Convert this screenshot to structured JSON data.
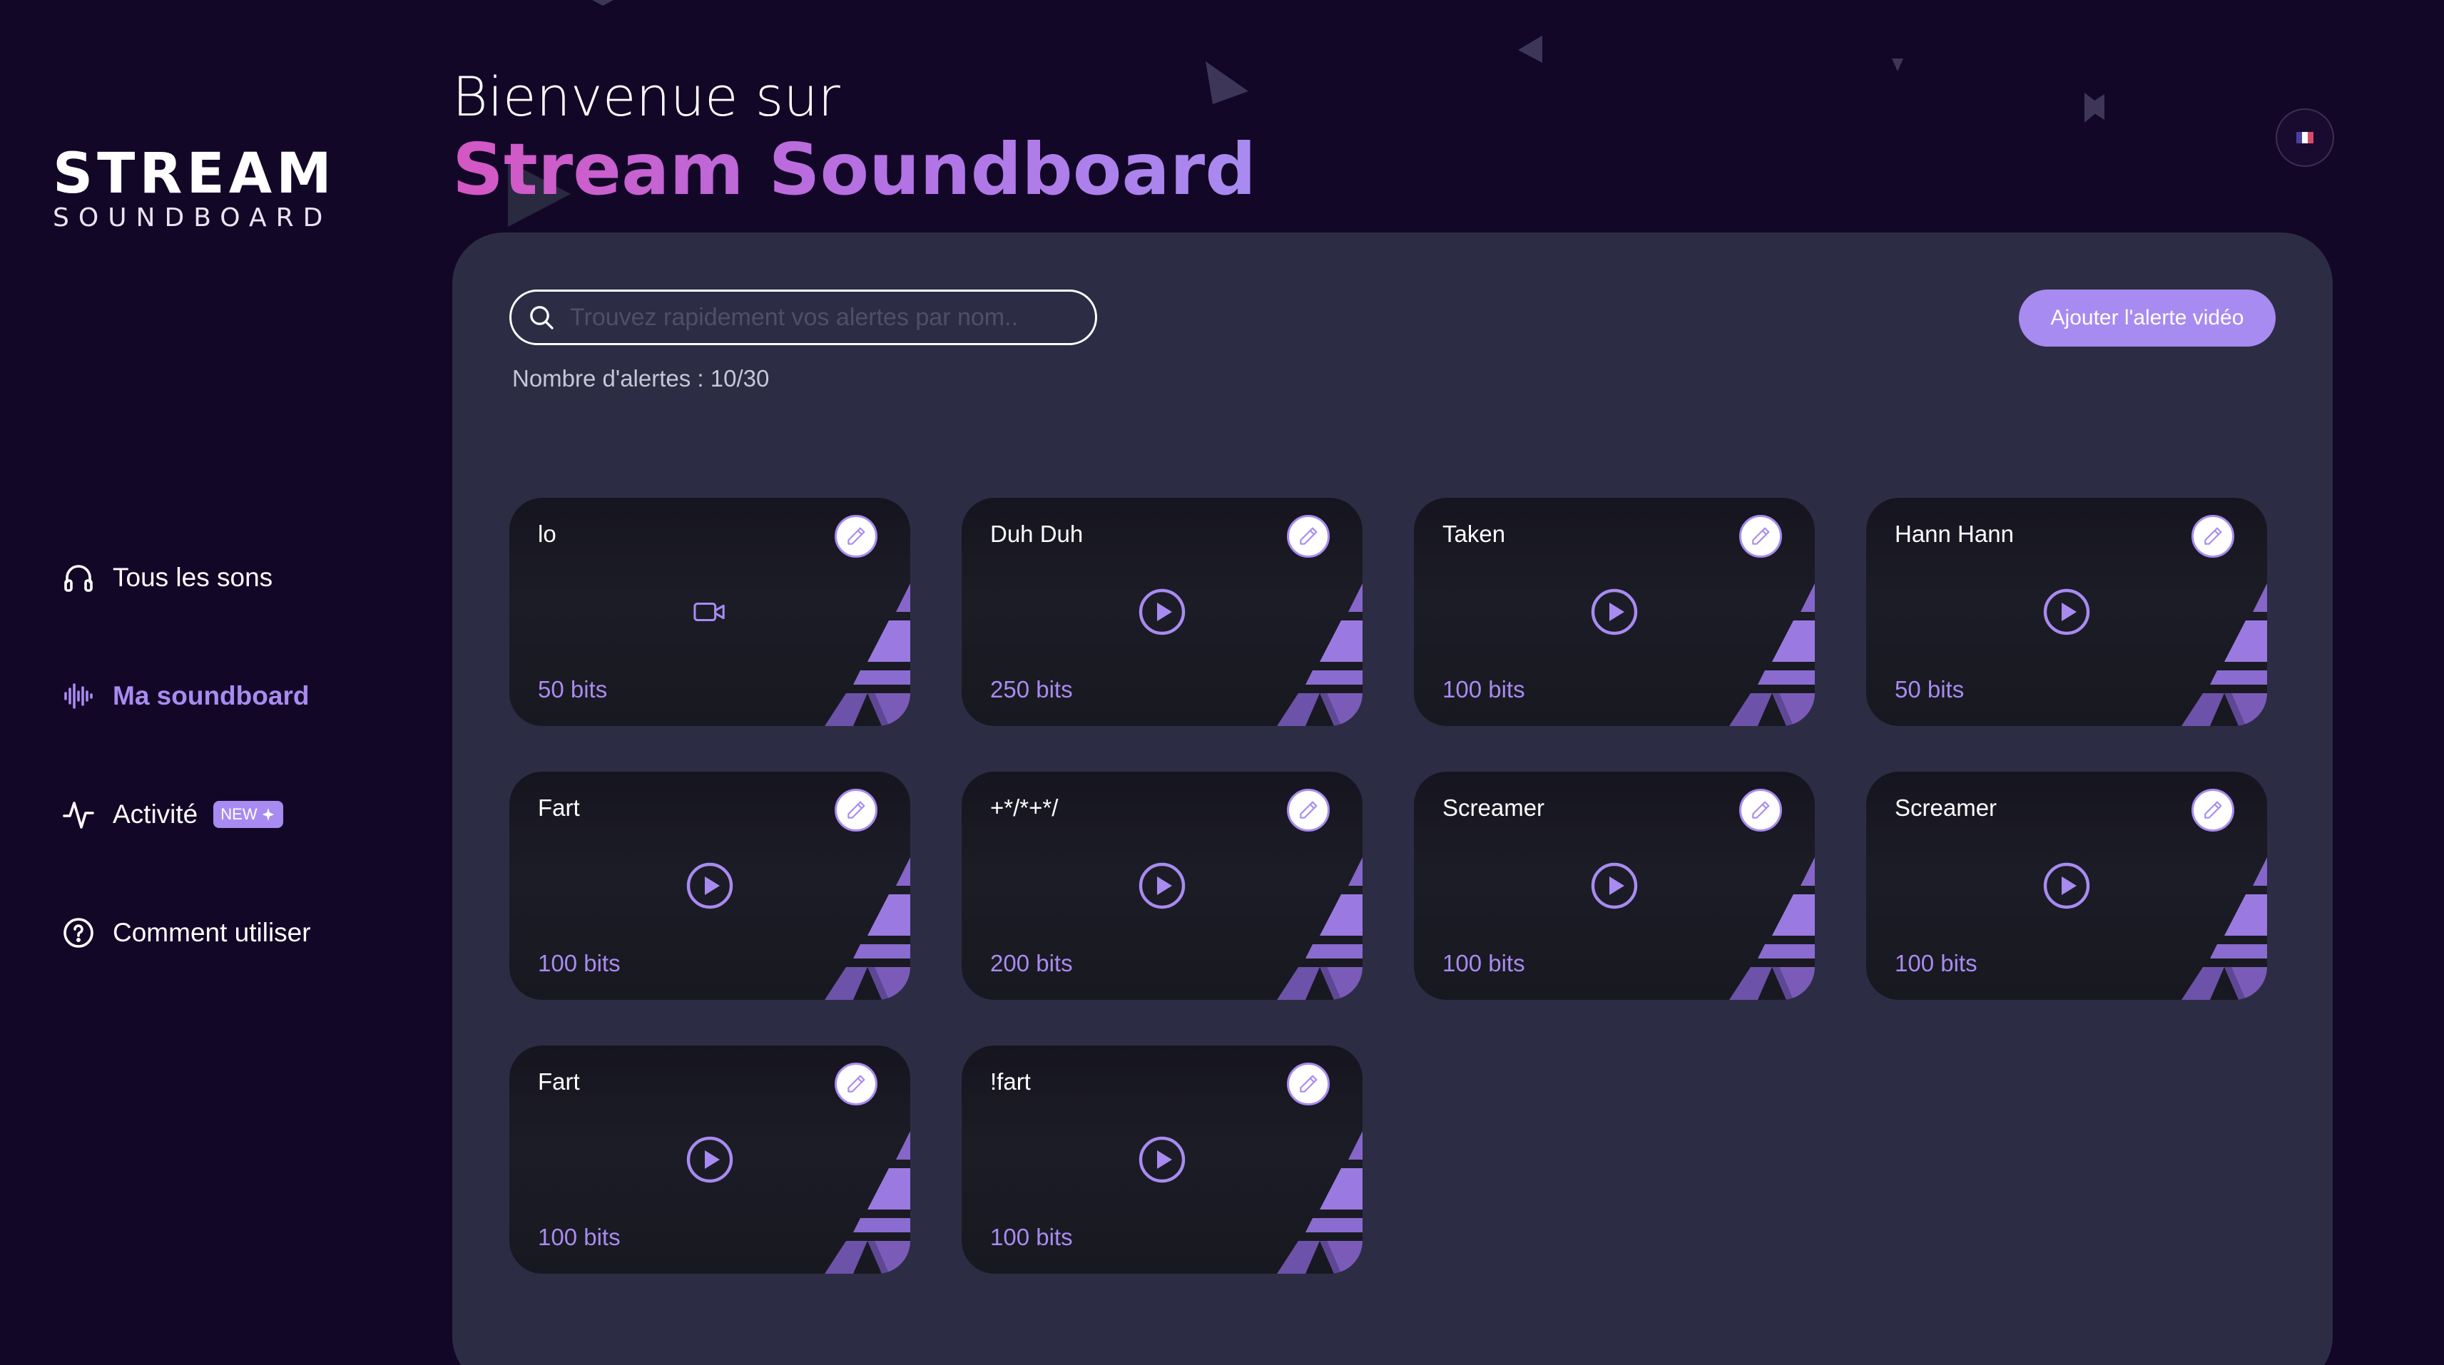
{
  "logo": {
    "title": "STREAM",
    "subtitle": "SOUNDBOARD"
  },
  "nav": [
    {
      "label": "Tous les sons",
      "icon": "headphones-icon",
      "active": false
    },
    {
      "label": "Ma soundboard",
      "icon": "soundwave-icon",
      "active": true
    },
    {
      "label": "Activité",
      "icon": "activity-icon",
      "active": false,
      "badge": "NEW"
    },
    {
      "label": "Comment utiliser",
      "icon": "help-circle-icon",
      "active": false
    }
  ],
  "header": {
    "welcome": "Bienvenue sur",
    "brand": "Stream Soundboard"
  },
  "search": {
    "placeholder": "Trouvez rapidement vos alertes par nom..",
    "value": ""
  },
  "alerts_count": "Nombre d'alertes : 10/30",
  "add_button": "Ajouter l'alerte vidéo",
  "cards": [
    {
      "name": "lo",
      "price": "50 bits",
      "icon": "video-camera-icon"
    },
    {
      "name": "Duh Duh",
      "price": "250 bits",
      "icon": "play-icon"
    },
    {
      "name": "Taken",
      "price": "100 bits",
      "icon": "play-icon"
    },
    {
      "name": "Hann Hann",
      "price": "50 bits",
      "icon": "play-icon"
    },
    {
      "name": "Fart",
      "price": "100 bits",
      "icon": "play-icon"
    },
    {
      "name": "+*/*+*/",
      "price": "200 bits",
      "icon": "play-icon"
    },
    {
      "name": "Screamer",
      "price": "100 bits",
      "icon": "play-icon"
    },
    {
      "name": "Screamer",
      "price": "100 bits",
      "icon": "play-icon"
    },
    {
      "name": "Fart",
      "price": "100 bits",
      "icon": "play-icon"
    },
    {
      "name": "!fart",
      "price": "100 bits",
      "icon": "play-icon"
    }
  ],
  "colors": {
    "background": "#130727",
    "panel": "#2c2d44",
    "accent": "#a88bf0",
    "brand_gradient_start": "#d457c3"
  }
}
